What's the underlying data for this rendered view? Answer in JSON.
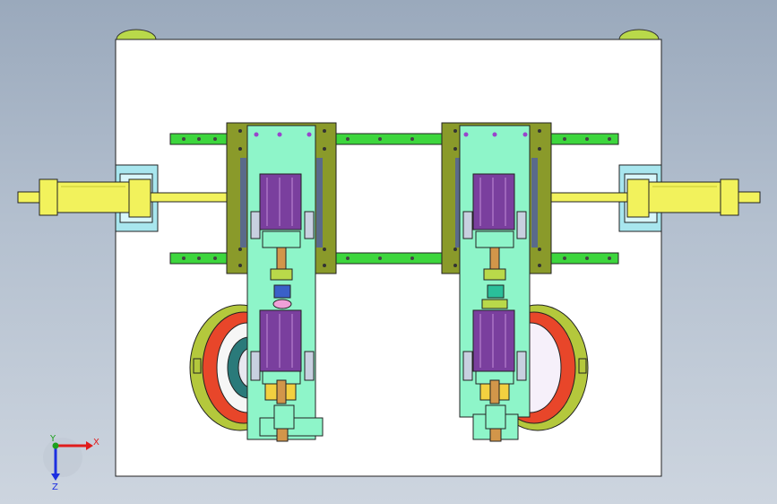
{
  "viewport": {
    "background_top": "#9aa9bc",
    "background_bottom": "#cdd5df"
  },
  "colors": {
    "base_plate": "#ffffff",
    "rail": "#3dd63d",
    "carriage": "#8a9a2a",
    "slide": "#8ef5c9",
    "motor": "#7a3f9e",
    "cylinder": "#f2f25c",
    "bracket": "#a8e6ee",
    "wheel_outer": "#b4c83c",
    "wheel_inner": "#e8462a",
    "rod": "#d2964a"
  },
  "triad": {
    "x_label": "X",
    "y_label": "Y",
    "z_label": "Z",
    "x_color": "#e01c1c",
    "y_color": "#1ca01c",
    "z_color": "#1c2fe0"
  }
}
